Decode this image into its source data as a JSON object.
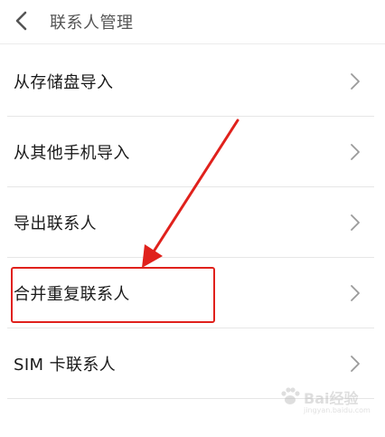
{
  "header": {
    "title": "联系人管理",
    "back_icon": "chevron-left-icon"
  },
  "menu": {
    "items": [
      {
        "label": "从存储盘导入",
        "icon": "chevron-right-icon"
      },
      {
        "label": "从其他手机导入",
        "icon": "chevron-right-icon"
      },
      {
        "label": "导出联系人",
        "icon": "chevron-right-icon"
      },
      {
        "label": "合并重复联系人",
        "icon": "chevron-right-icon",
        "highlighted": true
      },
      {
        "label": "SIM 卡联系人",
        "icon": "chevron-right-icon"
      }
    ]
  },
  "annotation": {
    "color": "#e0211c"
  },
  "watermark": {
    "text": "Bai经验",
    "sub": "jingyan.baidu.com"
  }
}
